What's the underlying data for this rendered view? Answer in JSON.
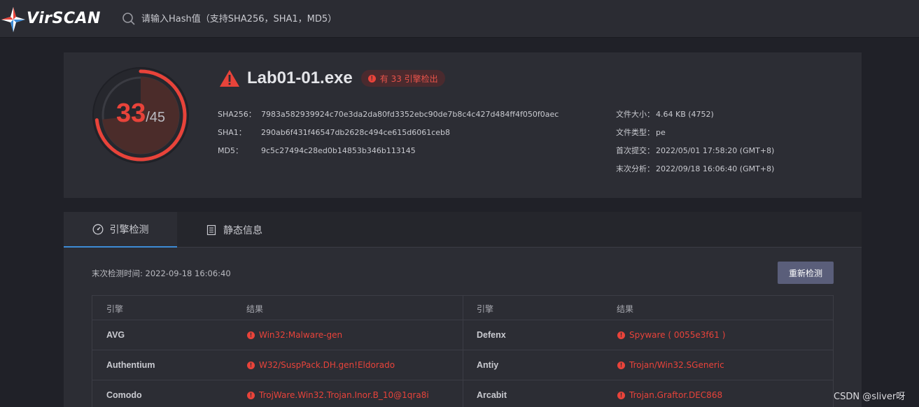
{
  "header": {
    "logo_text": "VirSCAN",
    "search_placeholder": "请输入Hash值（支持SHA256，SHA1，MD5）"
  },
  "summary": {
    "detected": "33",
    "total": "/45",
    "detection_ratio": 0.7333,
    "file_name": "Lab01-01.exe",
    "badge": "有 33 引擎检出",
    "hashes": [
      {
        "key": "SHA256：",
        "value": "7983a582939924c70e3da2da80fd3352ebc90de7b8c4c427d484ff4f050f0aec"
      },
      {
        "key": "SHA1：",
        "value": "290ab6f431f46547db2628c494ce615d6061ceb8"
      },
      {
        "key": "MD5：",
        "value": "9c5c27494c28ed0b14853b346b113145"
      }
    ],
    "meta": [
      {
        "key": "文件大小：",
        "value": "4.64 KB (4752)"
      },
      {
        "key": "文件类型：",
        "value": "pe"
      },
      {
        "key": "首次提交：",
        "value": "2022/05/01 17:58:20 (GMT+8)"
      },
      {
        "key": "末次分析：",
        "value": "2022/09/18 16:06:40 (GMT+8)"
      }
    ]
  },
  "tabs": [
    {
      "label": "引擎检测",
      "icon": "gauge-icon",
      "active": true
    },
    {
      "label": "静态信息",
      "icon": "document-icon",
      "active": false
    }
  ],
  "scan": {
    "last_scan": "末次检测时间: 2022-09-18 16:06:40",
    "rescan_label": "重新检测"
  },
  "table": {
    "headers": [
      "引擎",
      "结果",
      "引擎",
      "结果"
    ],
    "rows": [
      {
        "left_engine": "AVG",
        "left_result": "Win32:Malware-gen",
        "right_engine": "Defenx",
        "right_result": "Spyware ( 0055e3f61 )"
      },
      {
        "left_engine": "Authentium",
        "left_result": "W32/SuspPack.DH.gen!Eldorado",
        "right_engine": "Antiy",
        "right_result": "Trojan/Win32.SGeneric"
      },
      {
        "left_engine": "Comodo",
        "left_result": "TrojWare.Win32.Trojan.Inor.B_10@1qra8i",
        "right_engine": "Arcabit",
        "right_result": "Trojan.Graftor.DEC868"
      }
    ]
  },
  "watermark": "CSDN @sliver呀",
  "colors": {
    "accent_red": "#e8433a",
    "tab_underline": "#3d8bd6",
    "background": "#202128",
    "card": "#2c2d34"
  }
}
